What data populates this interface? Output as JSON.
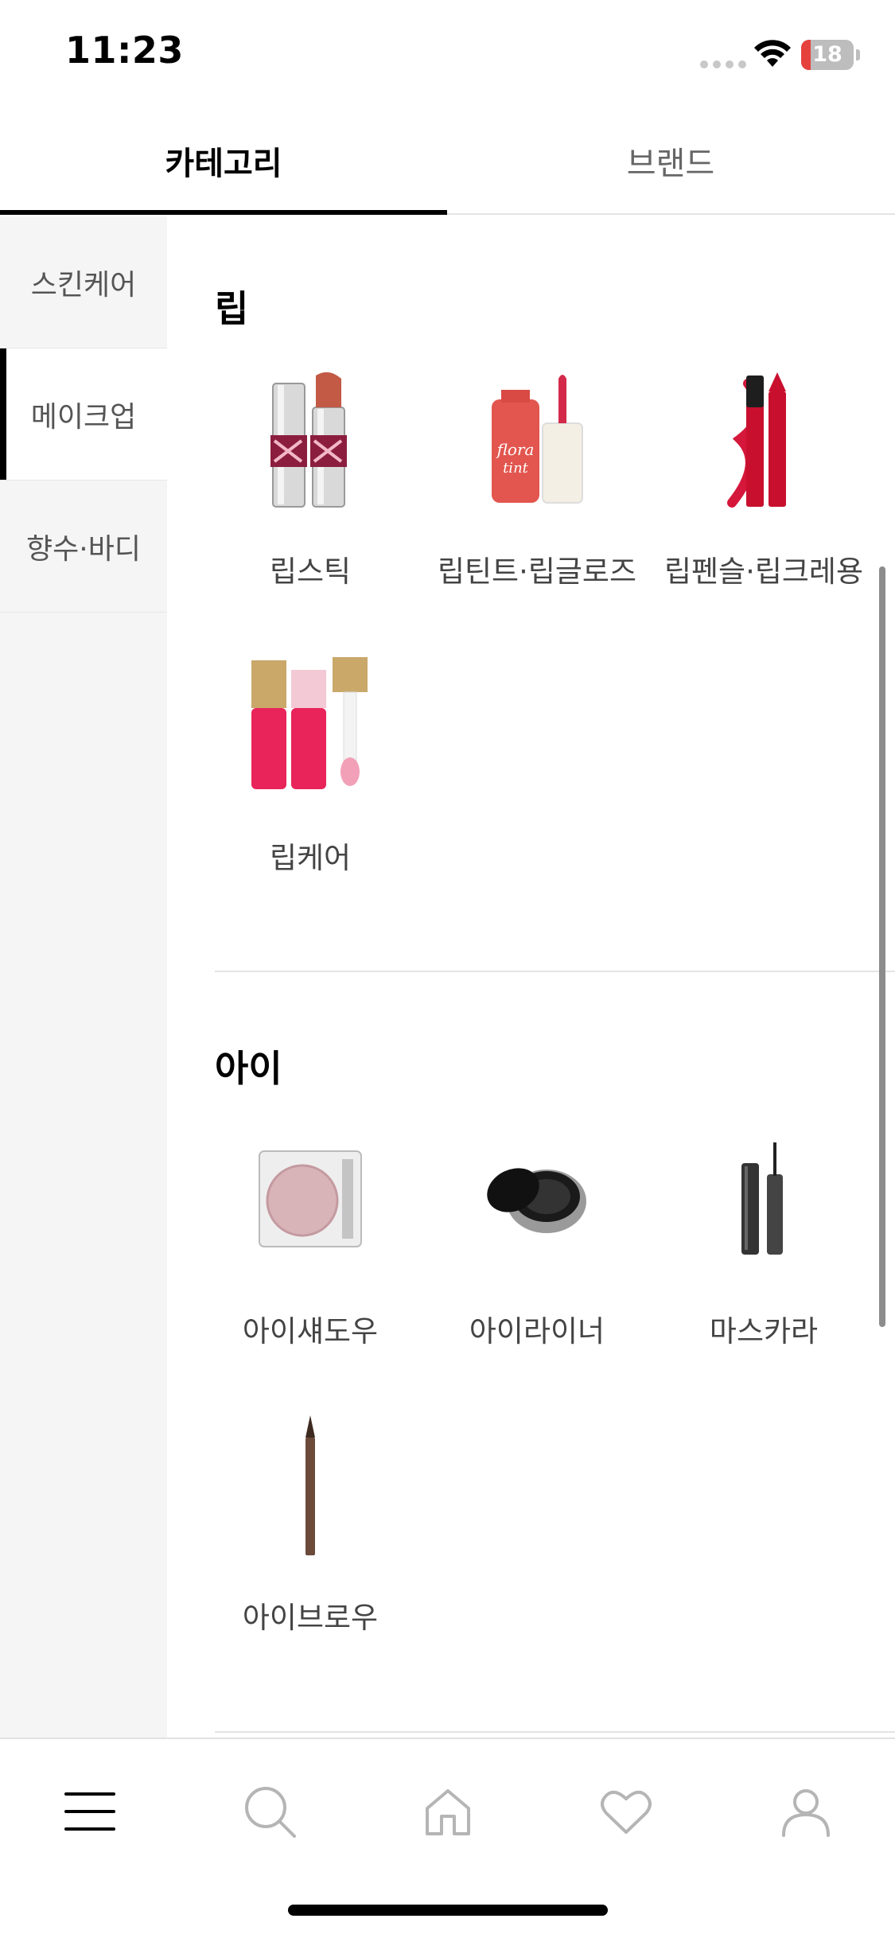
{
  "status_bar": {
    "time": "11:23",
    "battery": "18",
    "battery_level": 0.18
  },
  "top_tabs": [
    {
      "label": "카테고리",
      "active": true
    },
    {
      "label": "브랜드",
      "active": false
    }
  ],
  "sidebar": {
    "items": [
      {
        "label": "스킨케어",
        "active": false
      },
      {
        "label": "메이크업",
        "active": true
      },
      {
        "label": "향수·바디",
        "active": false
      }
    ]
  },
  "sections": [
    {
      "title": "립",
      "items": [
        {
          "label": "립스틱",
          "icon": "lipstick-icon"
        },
        {
          "label": "립틴트·립글로즈",
          "icon": "lip-tint-icon"
        },
        {
          "label": "립펜슬·립크레용",
          "icon": "lip-pencil-icon"
        },
        {
          "label": "립케어",
          "icon": "lip-oil-icon"
        }
      ]
    },
    {
      "title": "아이",
      "items": [
        {
          "label": "아이섀도우",
          "icon": "eyeshadow-icon"
        },
        {
          "label": "아이라이너",
          "icon": "eyeliner-icon"
        },
        {
          "label": "마스카라",
          "icon": "mascara-icon"
        },
        {
          "label": "아이브로우",
          "icon": "eyebrow-pencil-icon"
        }
      ]
    }
  ],
  "bottom_nav": [
    {
      "label": "menu",
      "icon": "menu-icon",
      "active": true
    },
    {
      "label": "search",
      "icon": "search-icon",
      "active": false
    },
    {
      "label": "home",
      "icon": "home-icon",
      "active": false
    },
    {
      "label": "wishlist",
      "icon": "heart-icon",
      "active": false
    },
    {
      "label": "my page",
      "icon": "user-icon",
      "active": false
    }
  ],
  "colors": {
    "accent": "#000000",
    "sidebar_bg": "#f5f5f5",
    "inactive_icon": "#b5b5b5",
    "battery_low": "#e6423d"
  }
}
